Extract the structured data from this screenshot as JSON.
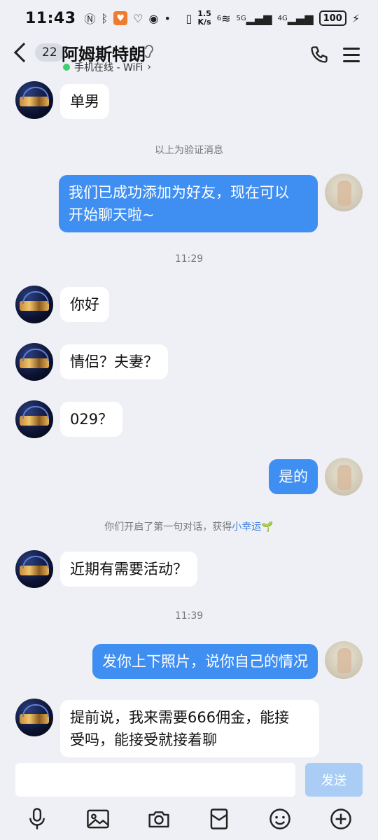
{
  "status_bar": {
    "time": "11:43",
    "speed_value": "1.5",
    "speed_unit": "K/s",
    "signal_5g": "5G",
    "signal_4g": "4G",
    "signal_6": "6",
    "battery": "100"
  },
  "header": {
    "unread_count": "22",
    "contact_name": "阿姆斯特朗",
    "online_status": "手机在线 - WiFi",
    "status_dot_color": "#3ecf6e"
  },
  "messages": [
    {
      "from": "them",
      "text": "单男"
    },
    {
      "system": "以上为验证消息"
    },
    {
      "from": "me",
      "line1": "我们已成功添加为好友，现在可以",
      "line2": "开始聊天啦~"
    },
    {
      "time": "11:29"
    },
    {
      "from": "them",
      "text": "你好"
    },
    {
      "from": "them",
      "text": "情侣？夫妻？"
    },
    {
      "from": "them",
      "text": "029？"
    },
    {
      "from": "me",
      "text": "是的"
    },
    {
      "system_prefix": "你们开启了第一句对话，获得",
      "system_link": "小幸运"
    },
    {
      "from": "them",
      "text": "近期有需要活动？"
    },
    {
      "time": "11:39"
    },
    {
      "from": "me",
      "text": "发你上下照片，说你自己的情况"
    },
    {
      "from": "them",
      "line1": "提前说，我来需要666佣金，能接",
      "line2": "受吗，能接受就接着聊"
    }
  ],
  "input_bar": {
    "send_label": "发送",
    "input_value": ""
  },
  "toolbar_icons": [
    "microphone-icon",
    "image-icon",
    "camera-icon",
    "red-packet-icon",
    "emoji-icon",
    "plus-icon"
  ],
  "colors": {
    "my_bubble": "#3f8ff2",
    "their_bubble": "#ffffff",
    "background": "#eef0f5",
    "send_button": "#a9cdf4",
    "link": "#3f7ee0"
  }
}
